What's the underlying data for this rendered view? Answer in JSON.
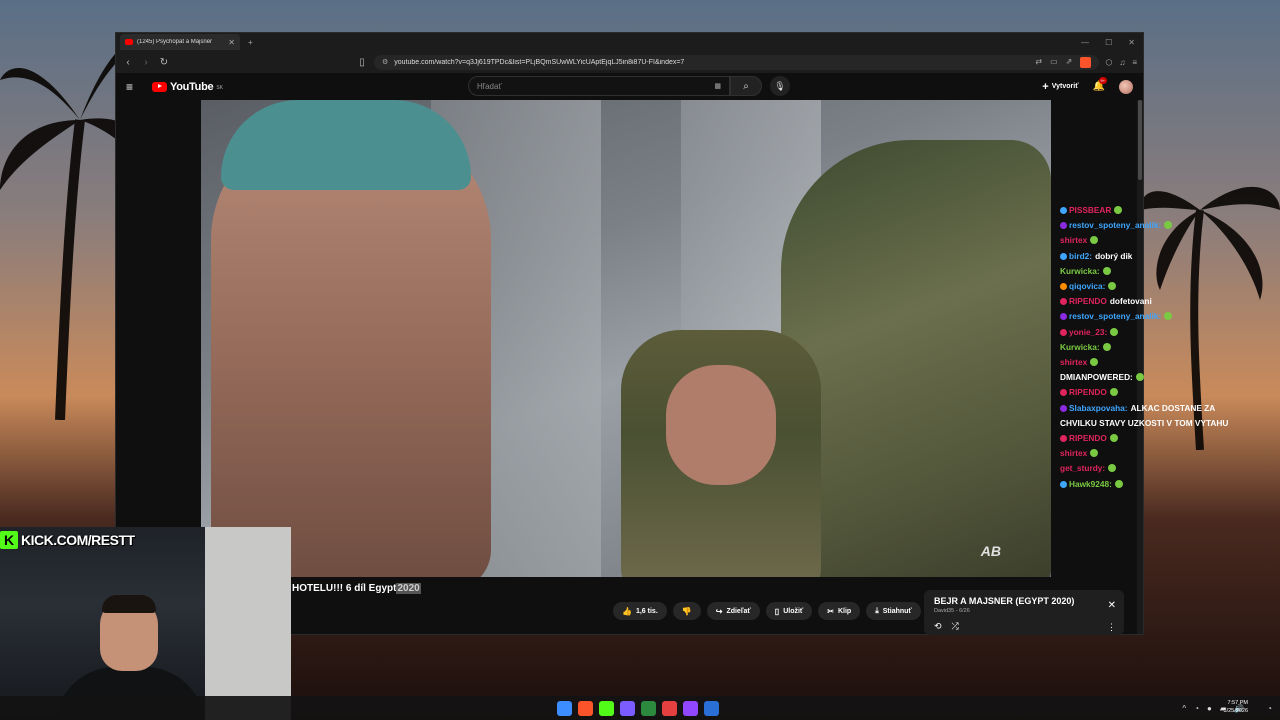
{
  "browser": {
    "tab_title": "(1245) Psychopat a Majsner",
    "url": "youtube.com/watch?v=q3Jj619TPDc&list=PLjBQmSUwWLYicUAptEjqLJ5in8i87U-FI&index=7",
    "icons": {
      "back": "back-arrow-icon",
      "forward": "forward-arrow-icon",
      "reload": "reload-icon",
      "bookmark": "bookmark-icon",
      "brave": "brave-shield-icon"
    }
  },
  "youtube": {
    "logo_text": "YouTube",
    "country_code": "SK",
    "search_placeholder": "Hľadať",
    "create_label": "Vytvoriť",
    "notification_count": "9+",
    "video_title": "HOTELU!!! 6 díl Egypt",
    "video_title_year": "2020",
    "actions": {
      "like": "1,6 tis.",
      "share": "Zdieľať",
      "save": "Uložiť",
      "clip": "Klip",
      "download": "Stiahnuť"
    },
    "watermark": "AB"
  },
  "miniplayer": {
    "title": "BEJR A MAJSNER (EGYPT 2020)",
    "subtitle": "David35 - 6/26"
  },
  "chat": [
    {
      "user": "PISSBEAR",
      "msg": "",
      "color": "#e0245e",
      "badge": "#3ea6ff"
    },
    {
      "user": "restov_spoteny_analik:",
      "msg": "",
      "color": "#3ea6ff",
      "badge": "#8a2be2"
    },
    {
      "user": "shirtex",
      "msg": "",
      "color": "#e0245e",
      "badge": ""
    },
    {
      "user": "bird2:",
      "msg": "dobrý dik",
      "color": "#3ea6ff",
      "badge": "#3ea6ff"
    },
    {
      "user": "Kurwicka:",
      "msg": "",
      "color": "#7ac943",
      "badge": ""
    },
    {
      "user": "qiqovica:",
      "msg": "",
      "color": "#3ea6ff",
      "badge": "#ff8c00"
    },
    {
      "user": "RIPENDO",
      "msg": "dofetovani",
      "color": "#e0245e",
      "badge": "#e0245e"
    },
    {
      "user": "restov_spoteny_analik:",
      "msg": "",
      "color": "#3ea6ff",
      "badge": "#8a2be2"
    },
    {
      "user": "yonie_23:",
      "msg": "",
      "color": "#e0245e",
      "badge": "#e0245e"
    },
    {
      "user": "Kurwicka:",
      "msg": "",
      "color": "#7ac943",
      "badge": ""
    },
    {
      "user": "shirtex",
      "msg": "",
      "color": "#e0245e",
      "badge": ""
    },
    {
      "user": "DMIANPOWERED:",
      "msg": "",
      "color": "#ffffff",
      "badge": ""
    },
    {
      "user": "RIPENDO",
      "msg": "",
      "color": "#e0245e",
      "badge": "#e0245e"
    },
    {
      "user": "Slabaxpovaha:",
      "msg": "ALKAC DOSTANE ZA",
      "color": "#3ea6ff",
      "badge": "#8a2be2"
    },
    {
      "user": "",
      "msg": "CHVILKU STAVY UZKOSTI V TOM VYTAHU",
      "color": "#ffffff",
      "badge": ""
    },
    {
      "user": "RIPENDO",
      "msg": "",
      "color": "#e0245e",
      "badge": "#e0245e"
    },
    {
      "user": "shirtex",
      "msg": "",
      "color": "#e0245e",
      "badge": ""
    },
    {
      "user": "get_sturdy:",
      "msg": "",
      "color": "#e0245e",
      "badge": ""
    },
    {
      "user": "Hawk9248:",
      "msg": "",
      "color": "#7ac943",
      "badge": "#3ea6ff"
    }
  ],
  "overlay": {
    "kick_url": "KICK.COM/RESTT",
    "kick_logo": "K"
  },
  "taskbar": {
    "time": "7:57 PM",
    "date": "3/25/2026",
    "app_colors": [
      "#3c8dff",
      "#fb542b",
      "#53fc18",
      "#7b5cff",
      "#2b8a3e",
      "#e54040",
      "#9146ff",
      "#2a6fd6"
    ]
  },
  "colors": {
    "youtube_red": "#ff0000",
    "kick_green": "#53fc18",
    "brave_orange": "#fb542b"
  }
}
